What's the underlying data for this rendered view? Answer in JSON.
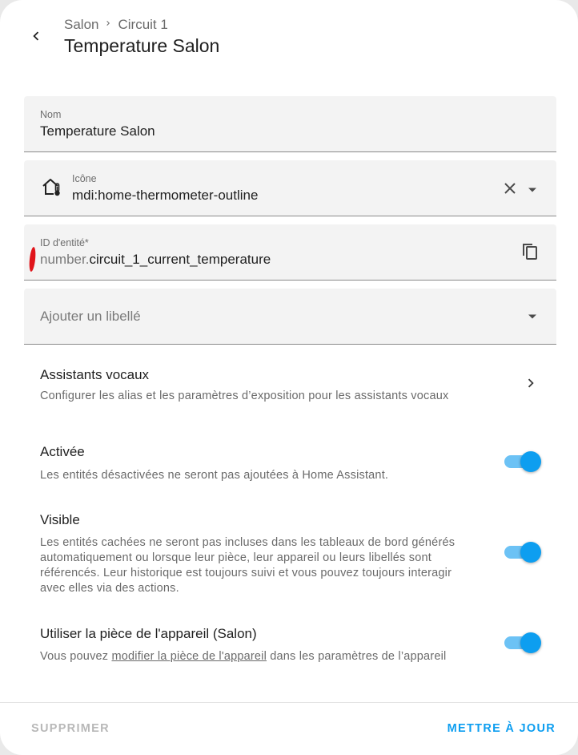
{
  "header": {
    "breadcrumb": [
      "Salon",
      "Circuit 1"
    ],
    "title": "Temperature Salon"
  },
  "fields": {
    "name": {
      "label": "Nom",
      "value": "Temperature Salon"
    },
    "icon": {
      "label": "Icône",
      "value": "mdi:home-thermometer-outline",
      "icon": "home-thermometer-outline-icon"
    },
    "entity_id": {
      "label": "ID d'entité*",
      "prefix": "number.",
      "value": "circuit_1_current_temperature"
    },
    "labels": {
      "placeholder": "Ajouter un libellé"
    }
  },
  "voice": {
    "title": "Assistants vocaux",
    "description": "Configurer les alias et les paramètres d’exposition pour les assistants vocaux"
  },
  "enabled": {
    "title": "Activée",
    "description": "Les entités désactivées ne seront pas ajoutées à Home Assistant.",
    "on": true
  },
  "visible": {
    "title": "Visible",
    "description": "Les entités cachées ne seront pas incluses dans les tableaux de bord générés automatiquement ou lorsque leur pièce, leur appareil ou leurs libellés sont référencés. Leur historique est toujours suivi et vous pouvez toujours interagir avec elles via des actions.",
    "on": true
  },
  "device_area": {
    "title": "Utiliser la pièce de l'appareil (Salon)",
    "desc_before": "Vous pouvez ",
    "link": "modifier la pièce de l'appareil",
    "desc_after": " dans les paramètres de l’appareil",
    "on": true
  },
  "footer": {
    "delete": "Supprimer",
    "update": "Mettre à jour"
  },
  "colors": {
    "accent": "#0d9ef0",
    "toggle_track": "#6cc2f5",
    "field_bg": "#f3f3f3",
    "disabled_text": "#b8b8b8"
  }
}
